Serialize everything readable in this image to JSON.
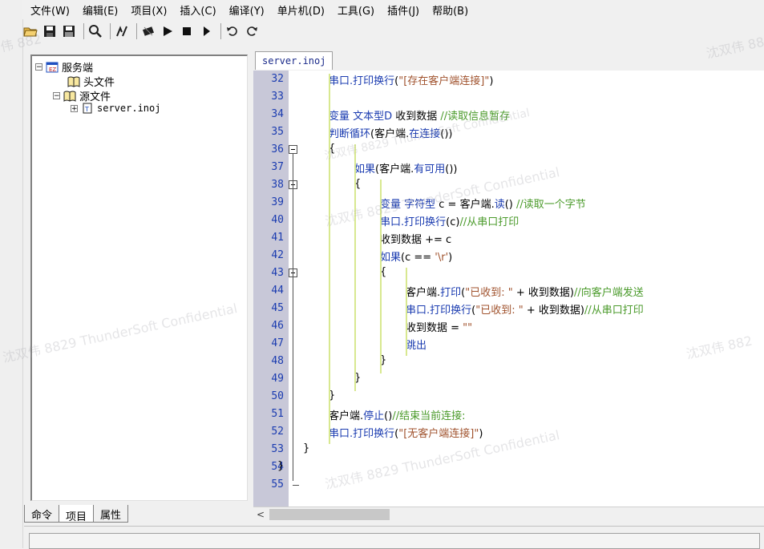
{
  "menu": [
    "文件(W)",
    "编辑(E)",
    "项目(X)",
    "插入(C)",
    "编译(Y)",
    "单片机(D)",
    "工具(G)",
    "插件(J)",
    "帮助(B)"
  ],
  "toolbar": {
    "icons": [
      "open-icon",
      "save-icon",
      "save-all-icon",
      "find-icon",
      "compile-icon",
      "chip-icon",
      "run-icon",
      "stop-icon",
      "step-icon",
      "undo-icon",
      "redo-icon"
    ]
  },
  "project_tree": {
    "root": "服务端",
    "headers": "头文件",
    "sources": "源文件",
    "file": "server.inoj"
  },
  "bottom_tabs": [
    "命令",
    "项目",
    "属性"
  ],
  "editor": {
    "tab_label": "server.inoj",
    "lines": [
      {
        "n": "32",
        "segs": [
          [
            "kw",
            "串口."
          ],
          [
            "kw",
            "打印换行"
          ],
          [
            "",
            "("
          ],
          [
            "st",
            "\"[存在客户端连接]\""
          ],
          [
            "",
            ")"
          ]
        ]
      },
      {
        "n": "33",
        "segs": []
      },
      {
        "n": "34",
        "segs": [
          [
            "kw",
            "变量 文本型D "
          ],
          [
            "",
            "收到数据 "
          ],
          [
            "cm",
            "//读取信息暂存"
          ]
        ]
      },
      {
        "n": "35",
        "segs": [
          [
            "kw",
            "判断循环"
          ],
          [
            "",
            "(客户端."
          ],
          [
            "kw",
            "在连接"
          ],
          [
            "",
            "())"
          ]
        ]
      },
      {
        "n": "36",
        "segs": [
          [
            "",
            "{"
          ]
        ]
      },
      {
        "n": "37",
        "segs": [
          [
            "kw",
            "如果"
          ],
          [
            "",
            "(客户端."
          ],
          [
            "kw",
            "有可用"
          ],
          [
            "",
            "())"
          ]
        ]
      },
      {
        "n": "38",
        "segs": [
          [
            "",
            "{"
          ]
        ]
      },
      {
        "n": "39",
        "segs": [
          [
            "kw",
            "变量 字符型 "
          ],
          [
            "",
            "c = 客户端."
          ],
          [
            "kw",
            "读"
          ],
          [
            "",
            "() "
          ],
          [
            "cm",
            "//读取一个字节"
          ]
        ]
      },
      {
        "n": "40",
        "segs": [
          [
            "kw",
            "串口."
          ],
          [
            "kw",
            "打印换行"
          ],
          [
            "",
            "(c)"
          ],
          [
            "cm",
            "//从串口打印"
          ]
        ]
      },
      {
        "n": "41",
        "segs": [
          [
            "",
            "收到数据 += c"
          ]
        ]
      },
      {
        "n": "42",
        "segs": [
          [
            "kw",
            "如果"
          ],
          [
            "",
            "(c == "
          ],
          [
            "st",
            "'\\r'"
          ],
          [
            "",
            ")"
          ]
        ]
      },
      {
        "n": "43",
        "segs": [
          [
            "",
            "{"
          ]
        ]
      },
      {
        "n": "44",
        "segs": [
          [
            "",
            "客户端."
          ],
          [
            "kw",
            "打印"
          ],
          [
            "",
            "("
          ],
          [
            "st",
            "\"已收到: \""
          ],
          [
            "",
            " + 收到数据)"
          ],
          [
            "cm",
            "//向客户端发送"
          ]
        ]
      },
      {
        "n": "45",
        "segs": [
          [
            "kw",
            "串口."
          ],
          [
            "kw",
            "打印换行"
          ],
          [
            "",
            "("
          ],
          [
            "st",
            "\"已收到: \""
          ],
          [
            "",
            " + 收到数据)"
          ],
          [
            "cm",
            "//从串口打印"
          ]
        ]
      },
      {
        "n": "46",
        "segs": [
          [
            "",
            "收到数据 = "
          ],
          [
            "st",
            "\"\""
          ]
        ]
      },
      {
        "n": "47",
        "segs": [
          [
            "kw",
            "跳出"
          ]
        ]
      },
      {
        "n": "48",
        "segs": [
          [
            "",
            "}"
          ]
        ]
      },
      {
        "n": "49",
        "segs": [
          [
            "",
            "}"
          ]
        ]
      },
      {
        "n": "50",
        "segs": [
          [
            "",
            "}"
          ]
        ]
      },
      {
        "n": "51",
        "segs": [
          [
            "",
            "客户端."
          ],
          [
            "kw",
            "停止"
          ],
          [
            "",
            "()"
          ],
          [
            "cm",
            "//结束当前连接:"
          ]
        ]
      },
      {
        "n": "52",
        "segs": [
          [
            "kw",
            "串口."
          ],
          [
            "kw",
            "打印换行"
          ],
          [
            "",
            "("
          ],
          [
            "st",
            "\"[无客户端连接]\""
          ],
          [
            "",
            ")"
          ]
        ]
      },
      {
        "n": "53",
        "segs": [
          [
            "",
            "}"
          ]
        ]
      },
      {
        "n": "54",
        "segs": [
          [
            "",
            "}"
          ]
        ]
      },
      {
        "n": "55",
        "segs": []
      }
    ]
  },
  "watermarks": [
    "沈双伟 8829 ThunderSoft Confidential",
    "沈双伟 8829 ThunderSoft Confidential",
    "沈双伟 8829 ThunderSoft Confidential",
    "沈双伟 8829 ThunderSoft Confidential",
    "沈双伟 882",
    "伟 882",
    "沈双伟 882"
  ],
  "colors": {
    "keyword": "#1a3bb0",
    "comment": "#4a9a2a",
    "string": "#a0522d",
    "gutter": "#c8c8d8"
  }
}
